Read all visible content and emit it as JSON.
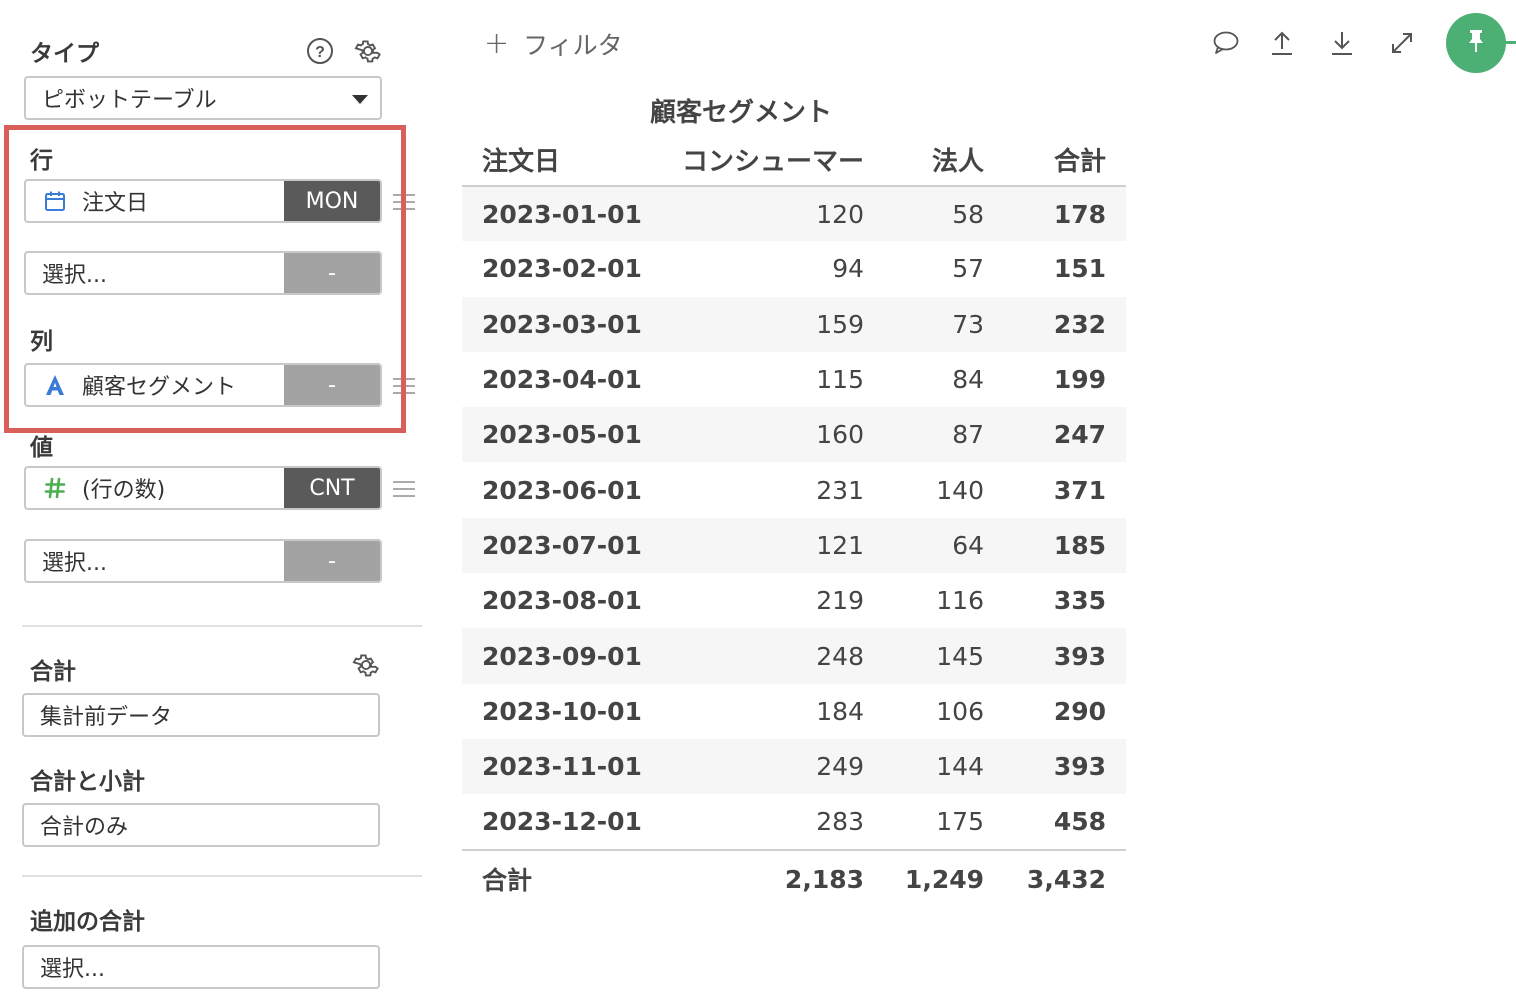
{
  "sidebar": {
    "type_label": "タイプ",
    "chart_type": "ピボットテーブル",
    "rows_label": "行",
    "rows_field_1": {
      "name": "注文日",
      "tag": "MON",
      "icon": "calendar-icon"
    },
    "rows_field_2": {
      "name": "選択...",
      "tag": "-"
    },
    "columns_label": "列",
    "columns_field_1": {
      "name": "顧客セグメント",
      "tag": "-",
      "icon": "text-type-icon"
    },
    "values_label": "値",
    "values_field_1": {
      "name": "(行の数)",
      "tag": "CNT",
      "icon": "number-type-icon"
    },
    "values_field_2": {
      "name": "選択...",
      "tag": "-"
    },
    "total_label": "合計",
    "total_value": "集計前データ",
    "subtotal_label": "合計と小計",
    "subtotal_value": "合計のみ",
    "extra_total_label": "追加の合計",
    "extra_total_value": "選択..."
  },
  "toolbar": {
    "filter_label": "フィルタ"
  },
  "colors": {
    "highlight": "#d9605a",
    "pin": "#4caf73",
    "tag_dark": "#5a5a5a",
    "tag_gray": "#a3a3a3"
  },
  "table": {
    "title": "顧客セグメント",
    "headers": [
      "注文日",
      "コンシューマー",
      "法人",
      "合計"
    ],
    "rows": [
      [
        "2023-01-01",
        "120",
        "58",
        "178"
      ],
      [
        "2023-02-01",
        "94",
        "57",
        "151"
      ],
      [
        "2023-03-01",
        "159",
        "73",
        "232"
      ],
      [
        "2023-04-01",
        "115",
        "84",
        "199"
      ],
      [
        "2023-05-01",
        "160",
        "87",
        "247"
      ],
      [
        "2023-06-01",
        "231",
        "140",
        "371"
      ],
      [
        "2023-07-01",
        "121",
        "64",
        "185"
      ],
      [
        "2023-08-01",
        "219",
        "116",
        "335"
      ],
      [
        "2023-09-01",
        "248",
        "145",
        "393"
      ],
      [
        "2023-10-01",
        "184",
        "106",
        "290"
      ],
      [
        "2023-11-01",
        "249",
        "144",
        "393"
      ],
      [
        "2023-12-01",
        "283",
        "175",
        "458"
      ]
    ],
    "footer": [
      "合計",
      "2,183",
      "1,249",
      "3,432"
    ]
  }
}
